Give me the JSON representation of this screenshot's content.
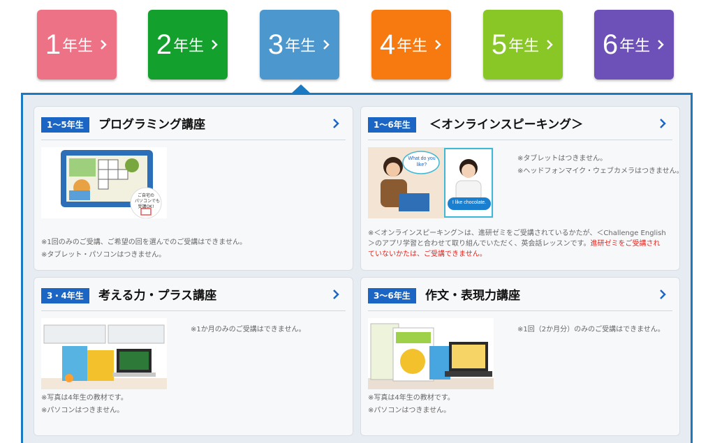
{
  "grade_tabs": [
    {
      "num": "1",
      "unit": "年生",
      "color": "#ee7285"
    },
    {
      "num": "2",
      "unit": "年生",
      "color": "#13a02c"
    },
    {
      "num": "3",
      "unit": "年生",
      "color": "#4c97cd"
    },
    {
      "num": "4",
      "unit": "年生",
      "color": "#f77a10"
    },
    {
      "num": "5",
      "unit": "年生",
      "color": "#88c726"
    },
    {
      "num": "6",
      "unit": "年生",
      "color": "#6d51b8"
    }
  ],
  "selected_grade": "3",
  "accent_color": "#1b79c1",
  "cards": {
    "programming": {
      "badge": "1〜5年生",
      "title": "プログラミング講座",
      "image_caption": "ご自宅の\nパソコンでも\n受講OK!",
      "notes": [
        "※1回のみのご受講、ご希望の回を選んでのご受講はできません。",
        "※タブレット・パソコンはつきません。"
      ]
    },
    "speaking": {
      "badge": "1〜6年生",
      "title": "＜オンラインスピーキング＞",
      "bubble_top": "What do you like?",
      "bubble_bottom": "I like chocolate.",
      "side_notes": [
        "※タブレットはつきません。",
        "※ヘッドフォンマイク・ウェブカメラはつきません。"
      ],
      "note_line1": "※＜オンラインスピーキング＞は、進研ゼミをご受講されているかたが、＜Challenge English",
      "note_line2": "＞のアプリ学習と合わせて取り組んでいただく、英会話レッスンです。",
      "note_red1": "進研ゼミをご受講され",
      "note_red2": "ていないかたは、ご受講できません。"
    },
    "thinking": {
      "badge": "3・4年生",
      "title": "考える力・プラス講座",
      "side_notes": [
        "※1か月のみのご受講はできません。"
      ],
      "notes": [
        "※写真は4年生の教材です。",
        "※パソコンはつきません。"
      ]
    },
    "writing": {
      "badge": "3〜6年生",
      "title": "作文・表現力講座",
      "side_notes": [
        "※1回（2か月分）のみのご受講はできません。"
      ],
      "notes": [
        "※写真は4年生の教材です。",
        "※パソコンはつきません。"
      ]
    }
  }
}
